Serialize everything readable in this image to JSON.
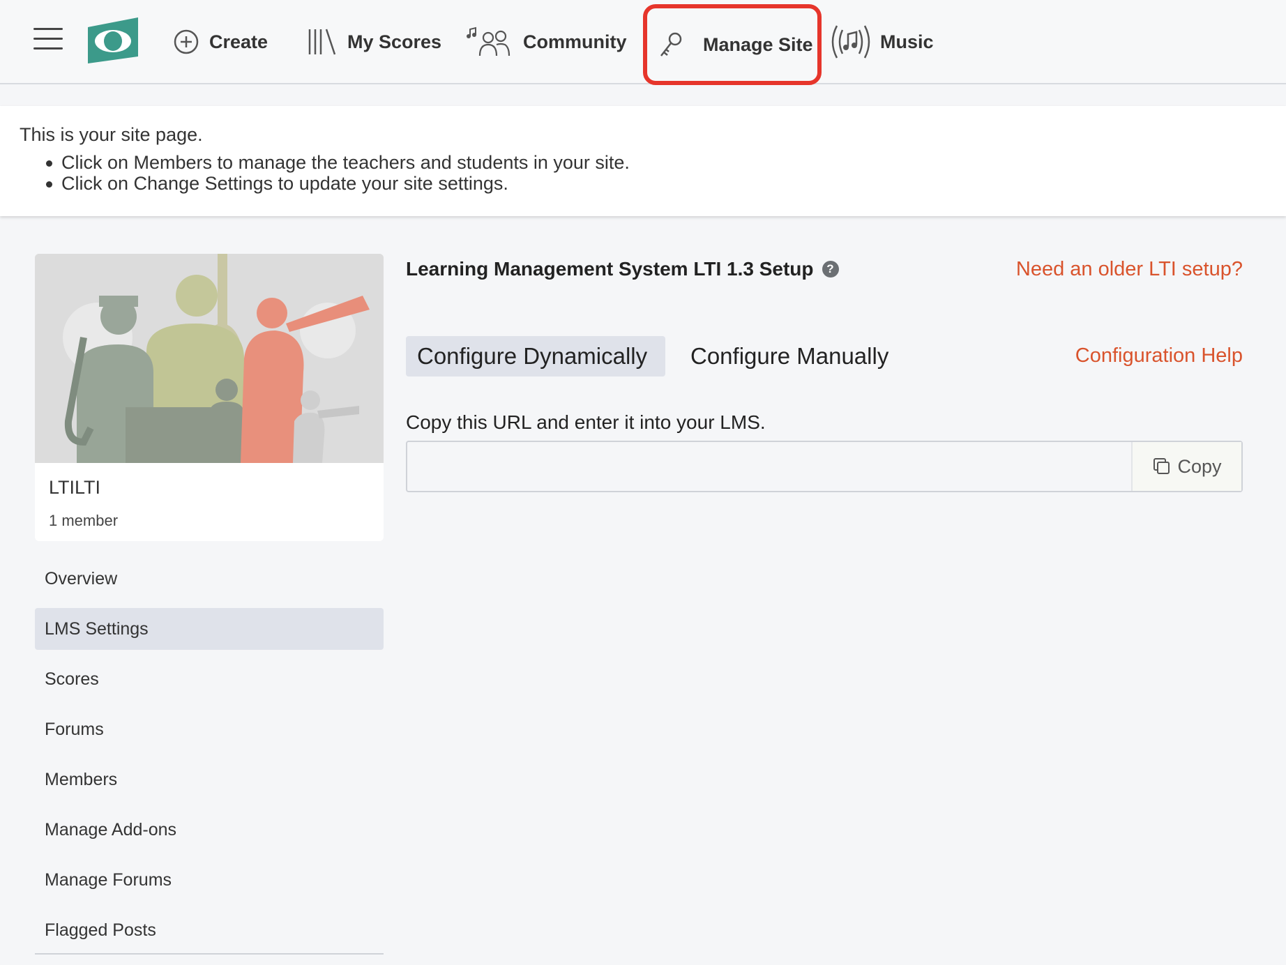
{
  "nav": {
    "create": "Create",
    "my_scores": "My Scores",
    "community": "Community",
    "manage_site": "Manage Site",
    "music": "Music",
    "logo_color": "#3c9a8a",
    "highlight_color": "#e6352b"
  },
  "banner": {
    "intro": "This is your site page.",
    "bullets": [
      "Click on Members to manage the teachers and students in your site.",
      "Click on Change Settings to update your site settings."
    ]
  },
  "site": {
    "name": "LTILTI",
    "members": "1 member"
  },
  "sidebar": {
    "items": [
      {
        "label": "Overview"
      },
      {
        "label": "LMS Settings",
        "active": true
      },
      {
        "label": "Scores"
      },
      {
        "label": "Forums"
      },
      {
        "label": "Members"
      },
      {
        "label": "Manage Add-ons"
      },
      {
        "label": "Manage Forums"
      },
      {
        "label": "Flagged Posts"
      }
    ]
  },
  "main": {
    "title": "Learning Management System LTI 1.3 Setup",
    "older_link": "Need an older LTI setup?",
    "tabs": [
      {
        "label": "Configure Dynamically",
        "active": true
      },
      {
        "label": "Configure Manually"
      }
    ],
    "config_help": "Configuration Help",
    "copy_instruction": "Copy this URL and enter it into your LMS.",
    "url_value": "",
    "copy_button": "Copy",
    "link_color": "#d9532c"
  }
}
